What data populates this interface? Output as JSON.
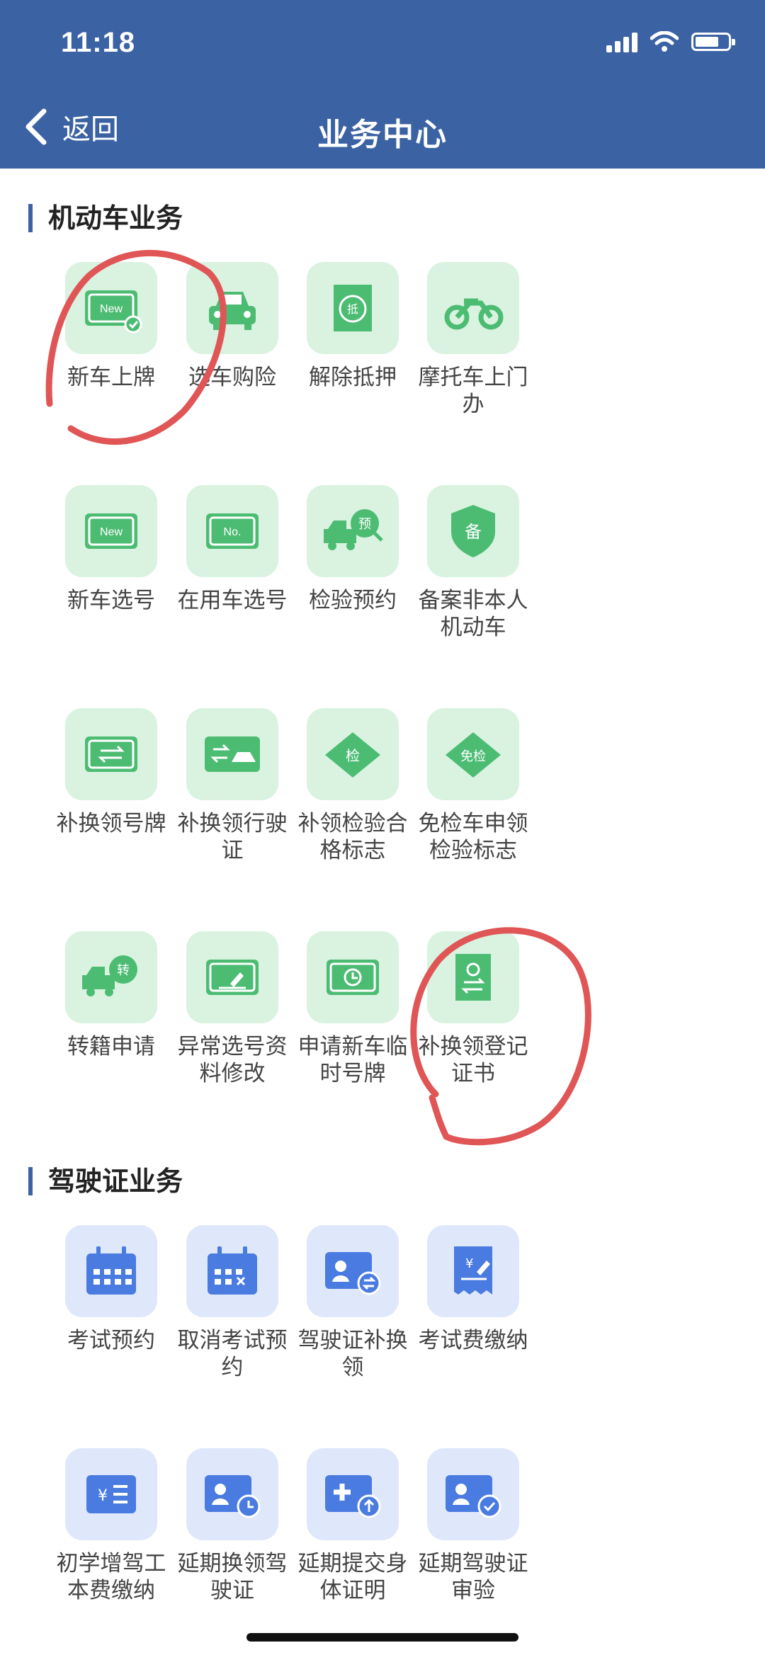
{
  "status": {
    "time": "11:18"
  },
  "header": {
    "back_label": "返回",
    "title": "业务中心"
  },
  "sections": [
    {
      "title": "机动车业务",
      "items": [
        {
          "label": "新车上牌",
          "icon": "new-plate-check-icon"
        },
        {
          "label": "选车购险",
          "icon": "car-icon"
        },
        {
          "label": "解除抵押",
          "icon": "mortgage-release-icon"
        },
        {
          "label": "摩托车上门办",
          "icon": "motorcycle-icon"
        },
        {
          "label": "新车选号",
          "icon": "new-plate-icon"
        },
        {
          "label": "在用车选号",
          "icon": "no-plate-icon"
        },
        {
          "label": "检验预约",
          "icon": "truck-appointment-icon"
        },
        {
          "label": "备案非本人机动车",
          "icon": "shield-record-icon"
        },
        {
          "label": "补换领号牌",
          "icon": "plate-exchange-icon"
        },
        {
          "label": "补换领行驶证",
          "icon": "license-exchange-icon"
        },
        {
          "label": "补领检验合格标志",
          "icon": "inspection-mark-icon"
        },
        {
          "label": "免检车申领检验标志",
          "icon": "exempt-inspection-icon"
        },
        {
          "label": "转籍申请",
          "icon": "transfer-truck-icon"
        },
        {
          "label": "异常选号资料修改",
          "icon": "edit-plate-icon"
        },
        {
          "label": "申请新车临时号牌",
          "icon": "temporary-plate-clock-icon"
        },
        {
          "label": "补换领登记证书",
          "icon": "registration-book-icon"
        }
      ]
    },
    {
      "title": "驾驶证业务",
      "items": [
        {
          "label": "考试预约",
          "icon": "calendar-icon"
        },
        {
          "label": "取消考试预约",
          "icon": "calendar-cancel-icon"
        },
        {
          "label": "驾驶证补换领",
          "icon": "id-card-exchange-icon"
        },
        {
          "label": "考试费缴纳",
          "icon": "fee-receipt-icon"
        },
        {
          "label": "初学增驾工本费缴纳",
          "icon": "yuan-list-icon"
        },
        {
          "label": "延期换领驾驶证",
          "icon": "id-card-clock-icon"
        },
        {
          "label": "延期提交身体证明",
          "icon": "medical-upload-icon"
        },
        {
          "label": "延期驾驶证审验",
          "icon": "id-card-check-icon"
        }
      ]
    }
  ],
  "colors": {
    "header_bg": "#3b62a3",
    "green_tile": "#d9f3e0",
    "green_icon": "#4cbc73",
    "blue_tile": "#dfe8fb",
    "blue_icon": "#4a7be0",
    "annotation": "#e05555"
  }
}
